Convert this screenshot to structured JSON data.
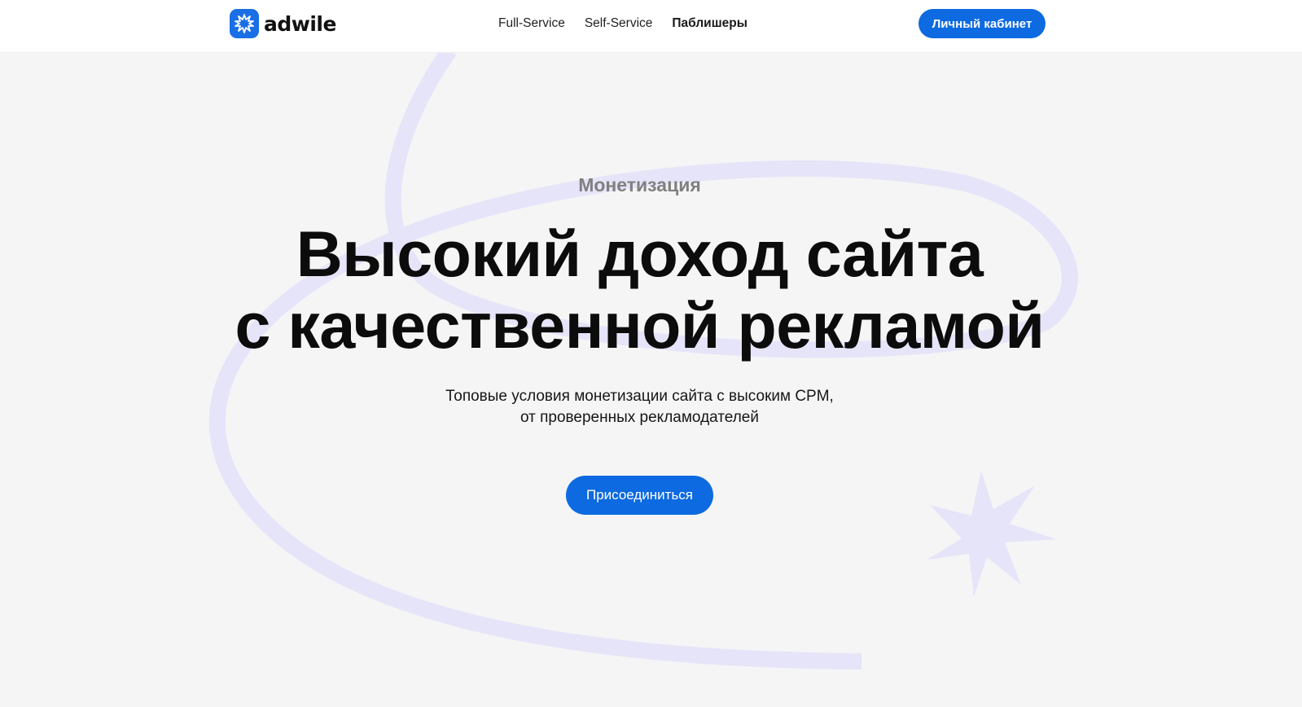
{
  "header": {
    "logo_text": "adwile",
    "nav": [
      {
        "label": "Full-Service"
      },
      {
        "label": "Self-Service"
      },
      {
        "label": "Паблишеры"
      }
    ],
    "cabinet_label": "Личный кабинет"
  },
  "hero": {
    "eyebrow": "Монетизация",
    "title_lines": [
      "Высокий доход сайта",
      "с качественной рекламой"
    ],
    "subtitle_lines": [
      "Топовые условия монетизации сайта с высоким CPM,",
      "от проверенных рекламодателей"
    ],
    "cta_label": "Присоединиться"
  },
  "colors": {
    "accent": "#0d6ae0",
    "background": "#f5f5f6",
    "decoration": "#e6e4f8",
    "text": "#0c0c0c",
    "muted": "#808080"
  },
  "icons": {
    "logo": "starburst-logo-icon",
    "decoration": "star-burst-decoration"
  }
}
